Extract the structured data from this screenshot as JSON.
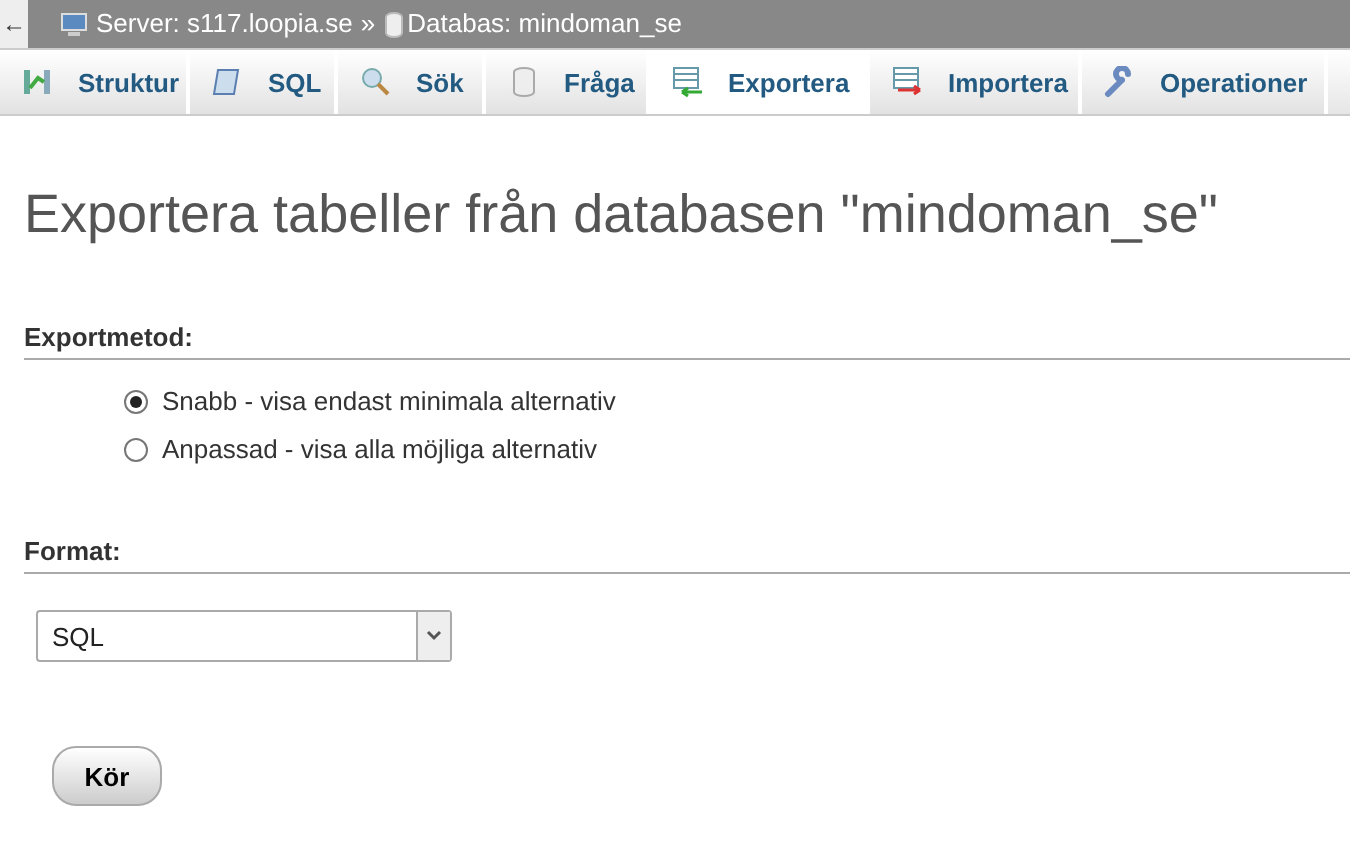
{
  "breadcrumb": {
    "back": "←",
    "server": "Server: s117.loopia.se",
    "separator": "»",
    "database": "Databas: mindoman_se"
  },
  "tabs": [
    {
      "label": "Struktur",
      "selected": false
    },
    {
      "label": "SQL",
      "selected": false
    },
    {
      "label": "Sök",
      "selected": false
    },
    {
      "label": "Fråga",
      "selected": false
    },
    {
      "label": "Exportera",
      "selected": true
    },
    {
      "label": "Importera",
      "selected": false
    },
    {
      "label": "Operationer",
      "selected": false
    }
  ],
  "heading": "Exportera tabeller från databasen \"mindoman_se\"",
  "export_method": {
    "label": "Exportmetod:",
    "options": [
      {
        "label": "Snabb - visa endast minimala alternativ",
        "selected": true
      },
      {
        "label": "Anpassad - visa alla möjliga alternativ",
        "selected": false
      }
    ]
  },
  "format": {
    "label": "Format:",
    "value": "SQL"
  },
  "submit": "Kör"
}
